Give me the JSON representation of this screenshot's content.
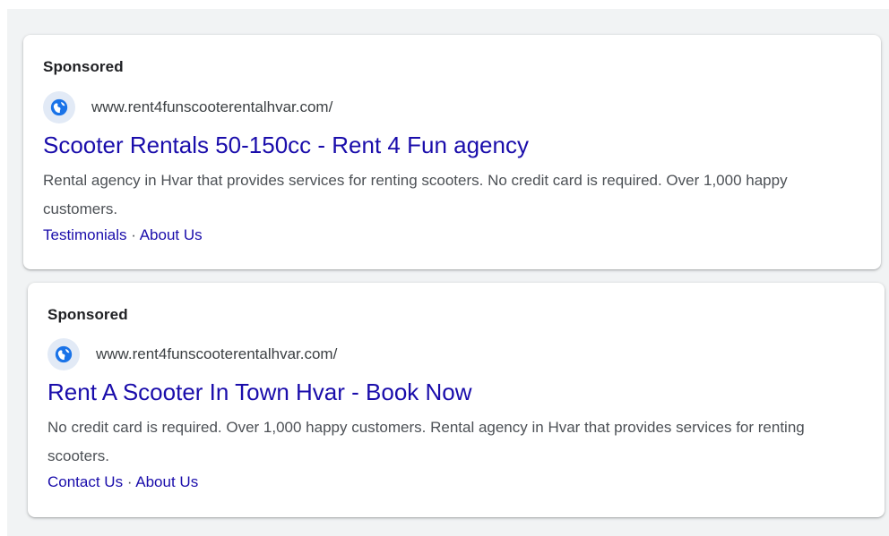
{
  "ads": [
    {
      "sponsored_label": "Sponsored",
      "display_url": "www.rent4funscooterentalhvar.com/",
      "favicon_icon": "globe-icon",
      "title": "Scooter Rentals 50-150cc - Rent 4 Fun agency",
      "description": "Rental agency in Hvar that provides services for renting scooters. No credit card is required. Over 1,000 happy customers.",
      "sitelinks": [
        "Testimonials",
        "About Us"
      ],
      "separator": " · "
    },
    {
      "sponsored_label": "Sponsored",
      "display_url": "www.rent4funscooterentalhvar.com/",
      "favicon_icon": "globe-icon",
      "title": "Rent A Scooter In Town Hvar - Book Now",
      "description": "No credit card is required. Over 1,000 happy customers. Rental agency in Hvar that provides services for renting scooters.",
      "sitelinks": [
        "Contact Us",
        "About Us"
      ],
      "separator": " · "
    }
  ],
  "colors": {
    "title_link": "#1a0dab",
    "favicon_bg": "#e2eaf6",
    "globe": "#1a73e8",
    "text": "#4d5156"
  }
}
